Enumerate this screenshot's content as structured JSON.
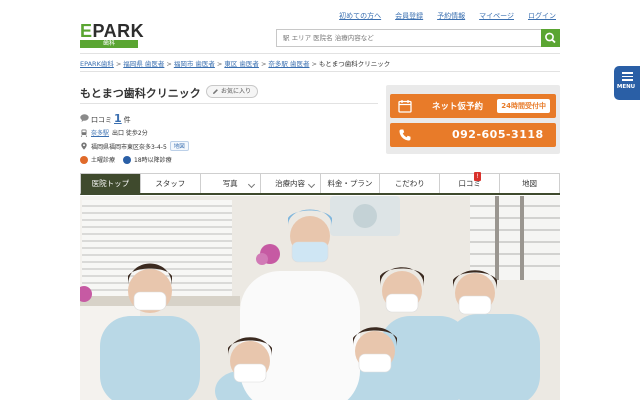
{
  "header": {
    "logo_text": "EPARK",
    "logo_sub": "歯科",
    "top_links": [
      "初めての方へ",
      "会員登録",
      "予約情報",
      "マイページ",
      "ログイン"
    ],
    "search_placeholder": "駅 エリア 医院名 治療内容など"
  },
  "breadcrumb": {
    "items": [
      "EPARK歯科",
      "福岡県 歯医者",
      "福岡市 歯医者",
      "東区 歯医者",
      "奈多駅 歯医者"
    ],
    "current": "もとまつ歯科クリニック"
  },
  "clinic": {
    "name": "もとまつ歯科クリニック",
    "favorite_label": "お気に入り",
    "review_label": "口コミ",
    "review_count": "1",
    "review_unit": "件",
    "station_link": "奈多駅",
    "station_detail": "出口 徒歩2分",
    "address": "福岡県福岡市東区奈多3-4-5",
    "map_label": "地図",
    "saturday_label": "土曜診療",
    "late_label": "18時以降診療"
  },
  "cta": {
    "reserve_label": "ネット仮予約",
    "reserve_tag": "24時間受付中",
    "phone": "092-605-3118"
  },
  "tabs": [
    {
      "label": "医院トップ",
      "active": true
    },
    {
      "label": "スタッフ"
    },
    {
      "label": "写真",
      "dropdown": true
    },
    {
      "label": "治療内容",
      "dropdown": true
    },
    {
      "label": "料金・プラン"
    },
    {
      "label": "こだわり"
    },
    {
      "label": "口コミ",
      "badge": "!"
    },
    {
      "label": "地図"
    }
  ],
  "side_menu": {
    "label": "MENU"
  },
  "colors": {
    "brand_green": "#5aa532",
    "cta_orange": "#e87b29",
    "tab_active": "#3f4a2d",
    "link_blue": "#3a6fb0",
    "menu_blue": "#2a5fa6"
  }
}
